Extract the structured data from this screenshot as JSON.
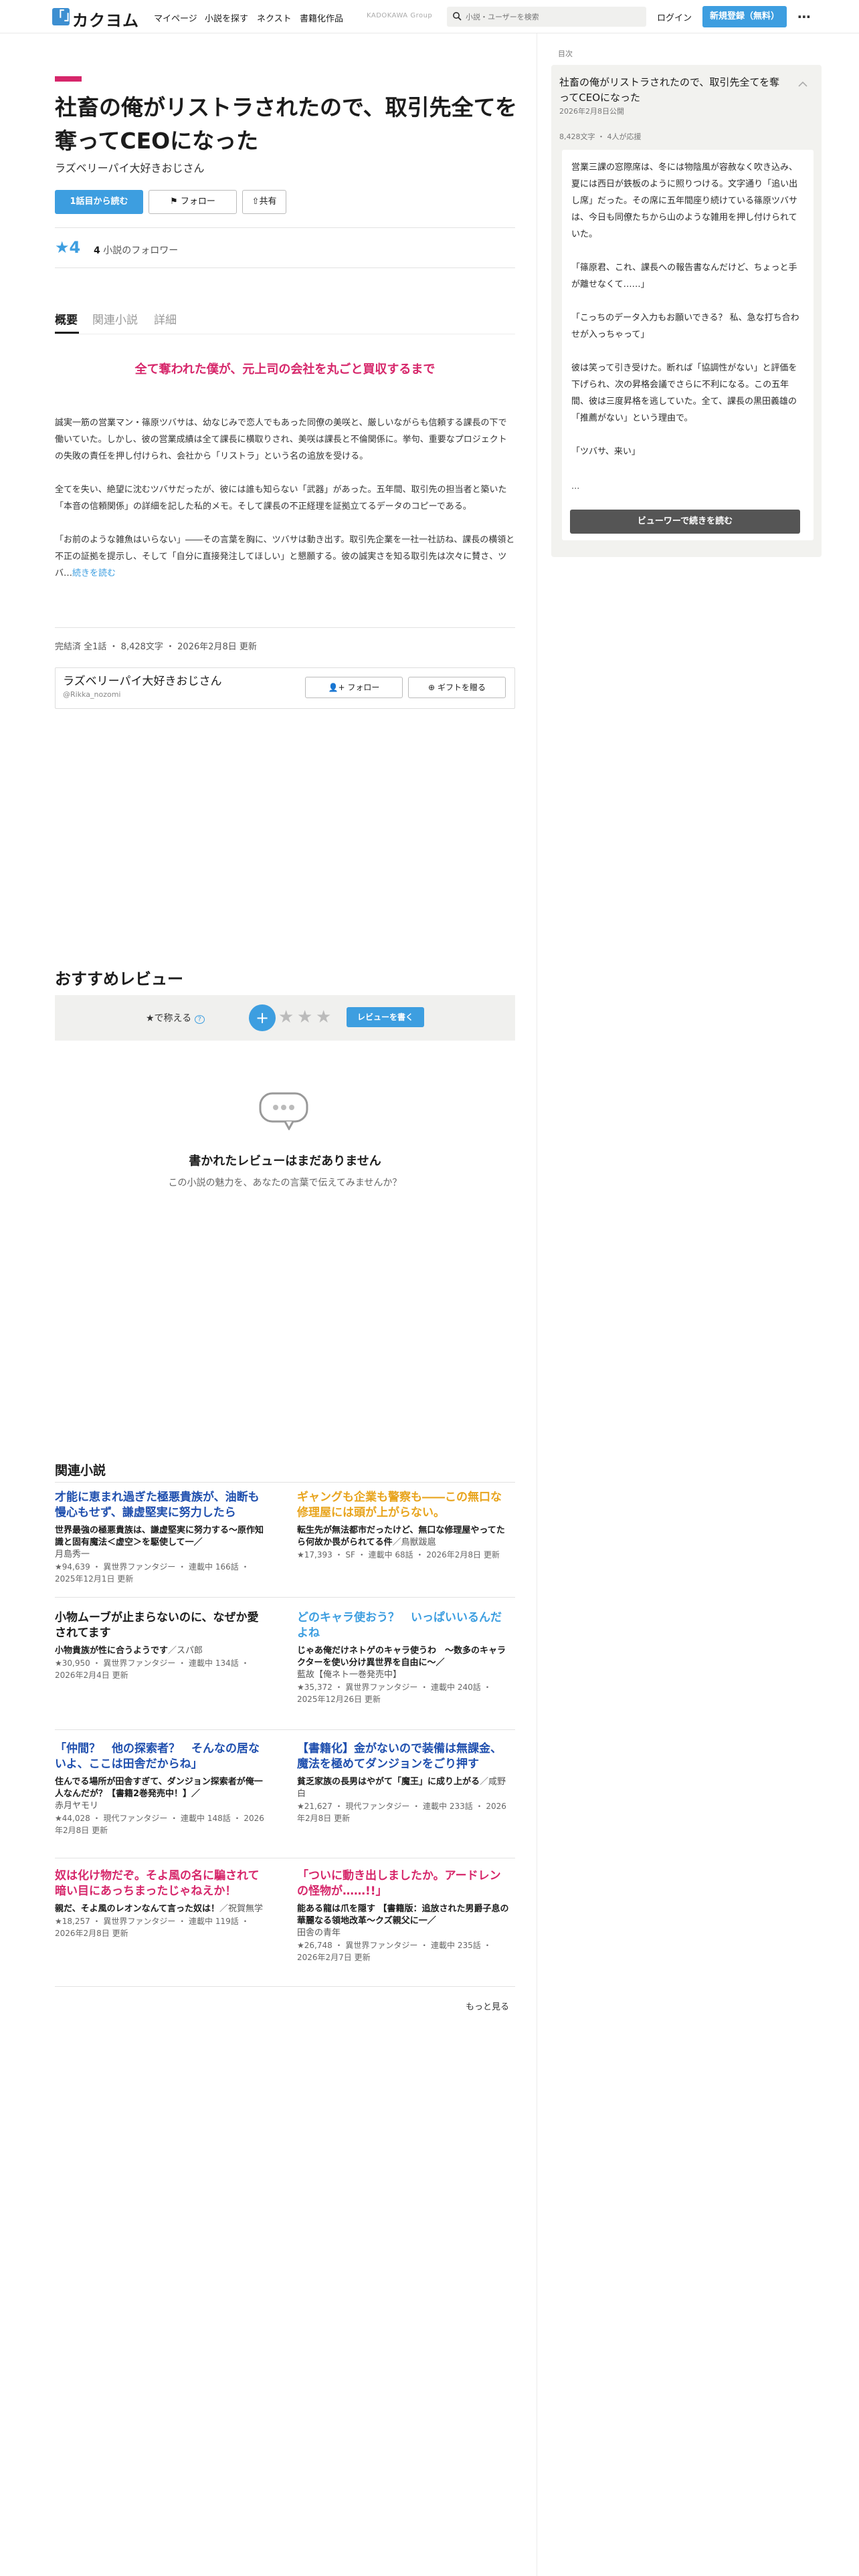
{
  "header": {
    "logo_mark": "「」",
    "logo_text": "カクヨム",
    "nav": [
      "マイページ",
      "小説を探す",
      "ネクスト",
      "書籍化作品"
    ],
    "group_label": "KADOKAWA Group",
    "search_placeholder": "小説・ユーザーを検索",
    "login": "ログイン",
    "register": "新規登録（無料）"
  },
  "work": {
    "title": "社畜の俺がリストラされたので、取引先全てを奪ってCEOになった",
    "author": "ラズベリーパイ大好きおじさん",
    "read_button": "1話目から読む",
    "follow_button": "フォロー",
    "share_button": "共有",
    "stars": "★4",
    "followers_count": "4",
    "followers_label": "小説のフォロワー",
    "tabs": [
      "概要",
      "関連小説",
      "詳細"
    ],
    "catchphrase": "全て奪われた僕が、元上司の会社を丸ごと買収するまで",
    "intro": [
      "誠実一筋の営業マン・篠原ツバサは、幼なじみで恋人でもあった同僚の美咲と、厳しいながらも信頼する課長の下で働いていた。しかし、彼の営業成績は全て課長に横取りされ、美咲は課長と不倫関係に。挙句、重要なプロジェクトの失敗の責任を押し付けられ、会社から「リストラ」という名の追放を受ける。",
      "全てを失い、絶望に沈むツバサだったが、彼には誰も知らない「武器」があった。五年間、取引先の担当者と築いた「本音の信頼関係」の詳細を記した私的メモ。そして課長の不正経理を証拠立てるデータのコピーである。",
      "「お前のような雑魚はいらない」――その言葉を胸に、ツバサは動き出す。取引先企業を一社一社訪ね、課長の横領と不正の証拠を提示し、そして「自分に直接発注してほしい」と懇願する。彼の誠実さを知る取引先は次々に賛さ、ツバ…"
    ],
    "read_more": "続きを読む",
    "status": "完結済 全1話 ・ 8,428文字 ・ 2026年2月8日 更新"
  },
  "author_card": {
    "name": "ラズベリーパイ大好きおじさん",
    "id": "@Rikka_nozomi",
    "follow": "フォロー",
    "gift": "ギフトを贈る"
  },
  "reviews": {
    "title": "おすすめレビュー",
    "label": "★で称える",
    "help": "?",
    "plus": "+",
    "write": "レビューを書く",
    "empty_title": "書かれたレビューはまだありません",
    "empty_sub": "この小説の魅力を、あなたの言葉で伝えてみませんか？"
  },
  "related": {
    "title": "関連小説",
    "more": "もっと見る",
    "items": [
      {
        "title": "才能に恵まれ過ぎた極悪貴族が、油断も慢心もせず、謙虚堅実に努力したら",
        "color": "#1f4fae",
        "catch": "世界最強の極悪貴族は、謙虚堅実に努力する〜原作知識と固有魔法＜虚空＞を駆使して一／",
        "author": "月島秀一",
        "meta": "★94,639 ・ 異世界ファンタジー ・ 連載中 166話 ・ 2025年12月1日 更新"
      },
      {
        "title": "ギャングも企業も警察も――この無口な修理屋には頭が上がらない。",
        "color": "#e8a41d",
        "catch": "転生先が無法都市だったけど、無口な修理屋やってたら何故か畏がられてる件",
        "author": "／鳥獣跋扈",
        "meta": "★17,393 ・ SF ・ 連載中 68話 ・ 2026年2月8日 更新"
      },
      {
        "title": "小物ムーブが止まらないのに、なぜか愛されてます",
        "color": "#1c1c1c",
        "catch": "小物貴族が性に合うようです",
        "author": "／スパ郎",
        "meta": "★30,950 ・ 異世界ファンタジー ・ 連載中 134話 ・ 2026年2月4日 更新"
      },
      {
        "title": "どのキャラ使おう？　いっぱいいるんだよね",
        "color": "#3d9ee0",
        "catch": "じゃあ俺だけネトゲのキャラ使うわ　〜数多のキャラクターを使い分け異世界を自由に〜／",
        "author": "藍故【俺ネト一巻発売中】",
        "meta": "★35,372 ・ 異世界ファンタジー ・ 連載中 240話 ・ 2025年12月26日 更新"
      },
      {
        "title": "「仲間？　他の探索者？　そんなの居ないよ、ここは田舎だからね」",
        "color": "#1f4fae",
        "catch": "住んでる場所が田舎すぎて、ダンジョン探索者が俺一人なんだが？【書籍2巻発売中！】／",
        "author": "赤月ヤモリ",
        "meta": "★44,028 ・ 現代ファンタジー ・ 連載中 148話 ・ 2026年2月8日 更新"
      },
      {
        "title": "【書籍化】金がないので装備は無課金、魔法を極めてダンジョンをごり押す",
        "color": "#1f4fae",
        "catch": "貧乏家族の長男はやがて「魔王」に成り上がる",
        "author": "／咸野白",
        "meta": "★21,627 ・ 現代ファンタジー ・ 連載中 233話 ・ 2026年2月8日 更新"
      },
      {
        "title": "奴は化け物だぞ。そよ風の名に騙されて暗い目にあっちまったじゃねえか！",
        "color": "#d6266a",
        "catch": "親だ、そよ風のレオンなんて言った奴は！",
        "author": "／祝賀無学",
        "meta": "★18,257 ・ 異世界ファンタジー ・ 連載中 119話 ・ 2026年2月8日 更新"
      },
      {
        "title": "「ついに動き出しましたか。アードレンの怪物が……!!」",
        "color": "#d6266a",
        "catch": "能ある龍は爪を隠す 【書籍版：追放された男爵子息の華麗なる領地改革〜クズ親父に一／",
        "author": "田舎の青年",
        "meta": "★26,748 ・ 異世界ファンタジー ・ 連載中 235話 ・ 2026年2月7日 更新"
      }
    ]
  },
  "preview": {
    "section_label": "目次",
    "title": "社畜の俺がリストラされたので、取引先全てを奪ってCEOになった",
    "date": "2026年2月8日公開",
    "meta": "8,428文字 ・ 4人が応援",
    "paragraphs": [
      "営業三課の窓際席は、冬には物陰風が容赦なく吹き込み、夏には西日が鉄板のように照りつける。文字通り「追い出し席」だった。その席に五年間座り続けている篠原ツバサは、今日も同僚たちから山のような雑用を押し付けられていた。",
      "「篠原君、これ、課長への報告書なんだけど、ちょっと手が離せなくて……」",
      "「こっちのデータ入力もお願いできる？ 私、急な打ち合わせが入っちゃって」",
      "彼は笑って引き受けた。断れば「協調性がない」と評価を下げられ、次の昇格会議でさらに不利になる。この五年間、彼は三度昇格を逃していた。全て、課長の黒田義雄の「推薦がない」という理由で。",
      "「ツバサ、来い」"
    ],
    "ellipsis": "...",
    "viewer_button": "ビューワーで続きを読む"
  }
}
